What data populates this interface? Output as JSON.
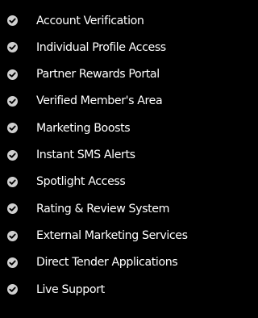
{
  "colors": {
    "background": "#000000",
    "text": "#ffffff",
    "icon_circle": "#cfcfcf",
    "icon_check": "#000000"
  },
  "features": {
    "icon": "check-circle-icon",
    "items": [
      {
        "label": "Account Verification"
      },
      {
        "label": "Individual Profile Access"
      },
      {
        "label": "Partner Rewards Portal"
      },
      {
        "label": "Verified Member's Area"
      },
      {
        "label": "Marketing Boosts"
      },
      {
        "label": "Instant SMS Alerts"
      },
      {
        "label": "Spotlight Access"
      },
      {
        "label": "Rating & Review System"
      },
      {
        "label": "External Marketing Services"
      },
      {
        "label": "Direct Tender Applications"
      },
      {
        "label": "Live Support"
      }
    ]
  }
}
